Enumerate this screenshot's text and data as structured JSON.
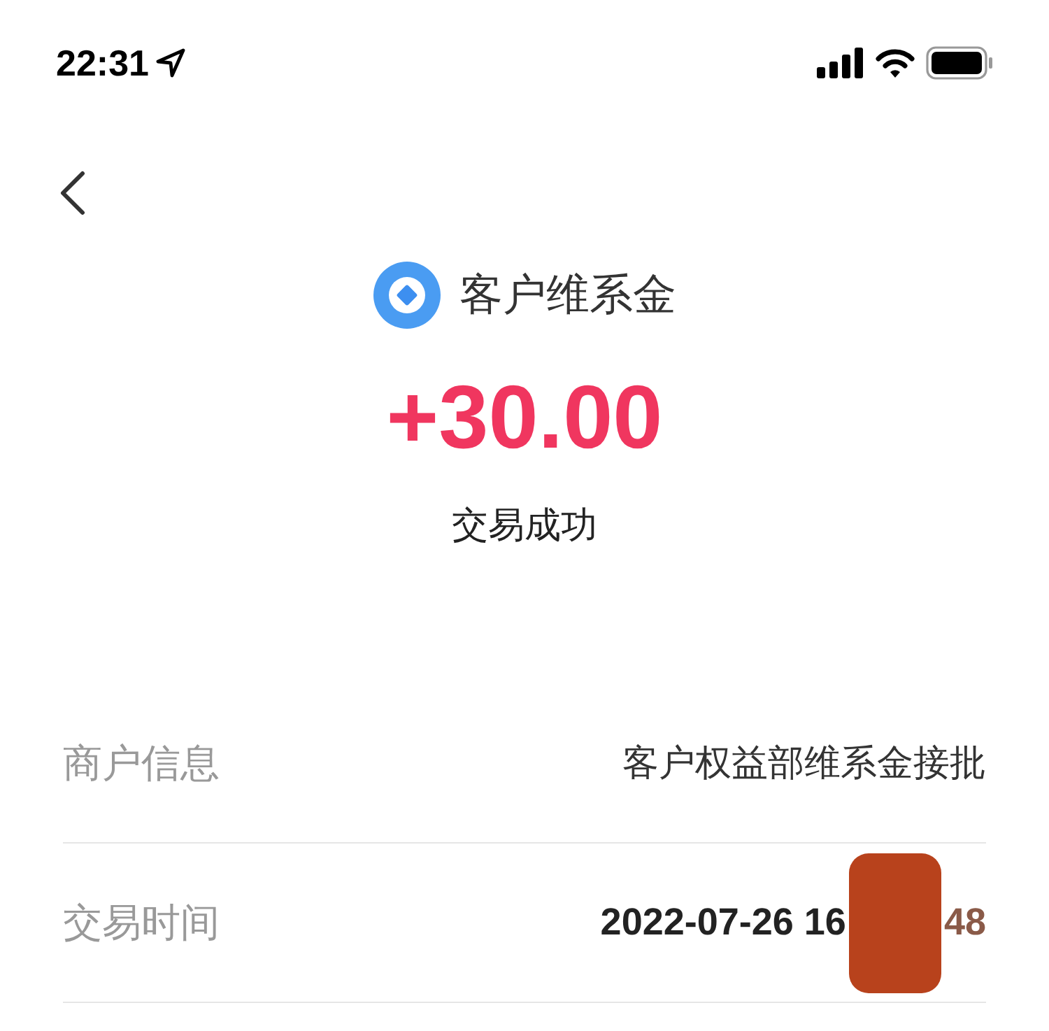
{
  "status_bar": {
    "time": "22:31"
  },
  "header": {
    "title": "客户维系金",
    "amount": "+30.00",
    "status": "交易成功"
  },
  "details": [
    {
      "label": "商户信息",
      "value": "客户权益部维系金接批",
      "redacted": false
    },
    {
      "label": "交易时间",
      "value": "2022-07-26 16",
      "value_tail": "48",
      "redacted": true
    }
  ]
}
